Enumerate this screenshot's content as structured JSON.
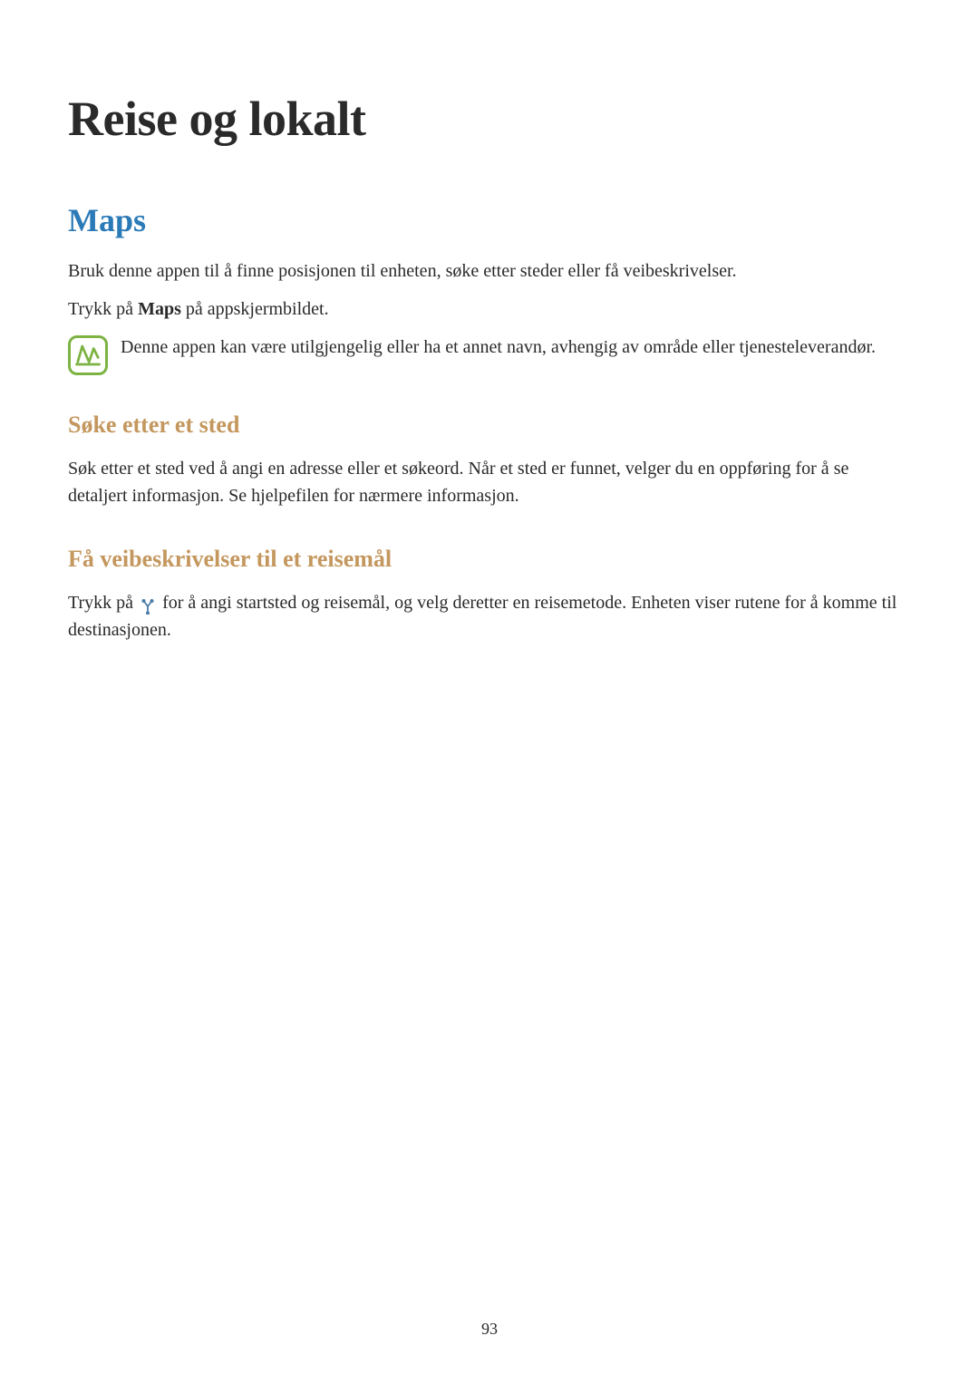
{
  "title": "Reise og lokalt",
  "section_maps": {
    "heading": "Maps",
    "intro": "Bruk denne appen til å finne posisjonen til enheten, søke etter steder eller få veibeskrivelser.",
    "tap_prefix": "Trykk på ",
    "tap_bold": "Maps",
    "tap_suffix": " på appskjermbildet.",
    "note": "Denne appen kan være utilgjengelig eller ha et annet navn, avhengig av område eller tjenesteleverandør."
  },
  "section_search": {
    "heading": "Søke etter et sted",
    "body": "Søk etter et sted ved å angi en adresse eller et søkeord. Når et sted er funnet, velger du en oppføring for å se detaljert informasjon. Se hjelpefilen for nærmere informasjon."
  },
  "section_directions": {
    "heading": "Få veibeskrivelser til et reisemål",
    "body_prefix": "Trykk på ",
    "body_suffix": " for å angi startsted og reisemål, og velg deretter en reisemetode. Enheten viser rutene for å komme til destinasjonen."
  },
  "page_number": "93"
}
